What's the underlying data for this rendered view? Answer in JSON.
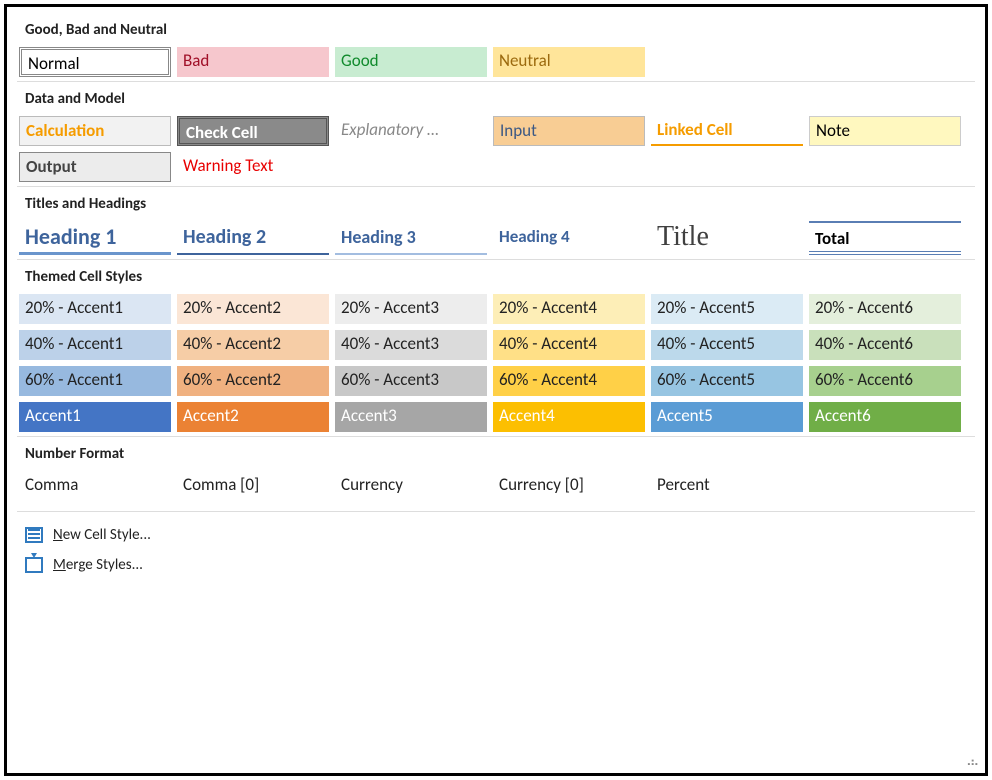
{
  "sections": {
    "gbn": "Good, Bad and Neutral",
    "data_model": "Data and Model",
    "titles": "Titles and Headings",
    "themed": "Themed Cell Styles",
    "numfmt": "Number Format"
  },
  "gbn": {
    "normal": "Normal",
    "bad": "Bad",
    "good": "Good",
    "neutral": "Neutral"
  },
  "dm": {
    "calc": "Calculation",
    "check": "Check Cell",
    "expl": "Explanatory …",
    "input": "Input",
    "linked": "Linked Cell",
    "note": "Note",
    "output": "Output",
    "warn": "Warning Text"
  },
  "th": {
    "h1": "Heading 1",
    "h2": "Heading 2",
    "h3": "Heading 3",
    "h4": "Heading 4",
    "title": "Title",
    "total": "Total"
  },
  "acc": {
    "r20": [
      "20% - Accent1",
      "20% - Accent2",
      "20% - Accent3",
      "20% - Accent4",
      "20% - Accent5",
      "20% - Accent6"
    ],
    "r40": [
      "40% - Accent1",
      "40% - Accent2",
      "40% - Accent3",
      "40% - Accent4",
      "40% - Accent5",
      "40% - Accent6"
    ],
    "r60": [
      "60% - Accent1",
      "60% - Accent2",
      "60% - Accent3",
      "60% - Accent4",
      "60% - Accent5",
      "60% - Accent6"
    ],
    "r100": [
      "Accent1",
      "Accent2",
      "Accent3",
      "Accent4",
      "Accent5",
      "Accent6"
    ]
  },
  "nf": {
    "comma": "Comma",
    "comma0": "Comma [0]",
    "currency": "Currency",
    "currency0": "Currency [0]",
    "percent": "Percent"
  },
  "footer": {
    "new_pre": "N",
    "new_rest": "ew Cell Style...",
    "merge_pre": "M",
    "merge_rest": "erge Styles..."
  }
}
